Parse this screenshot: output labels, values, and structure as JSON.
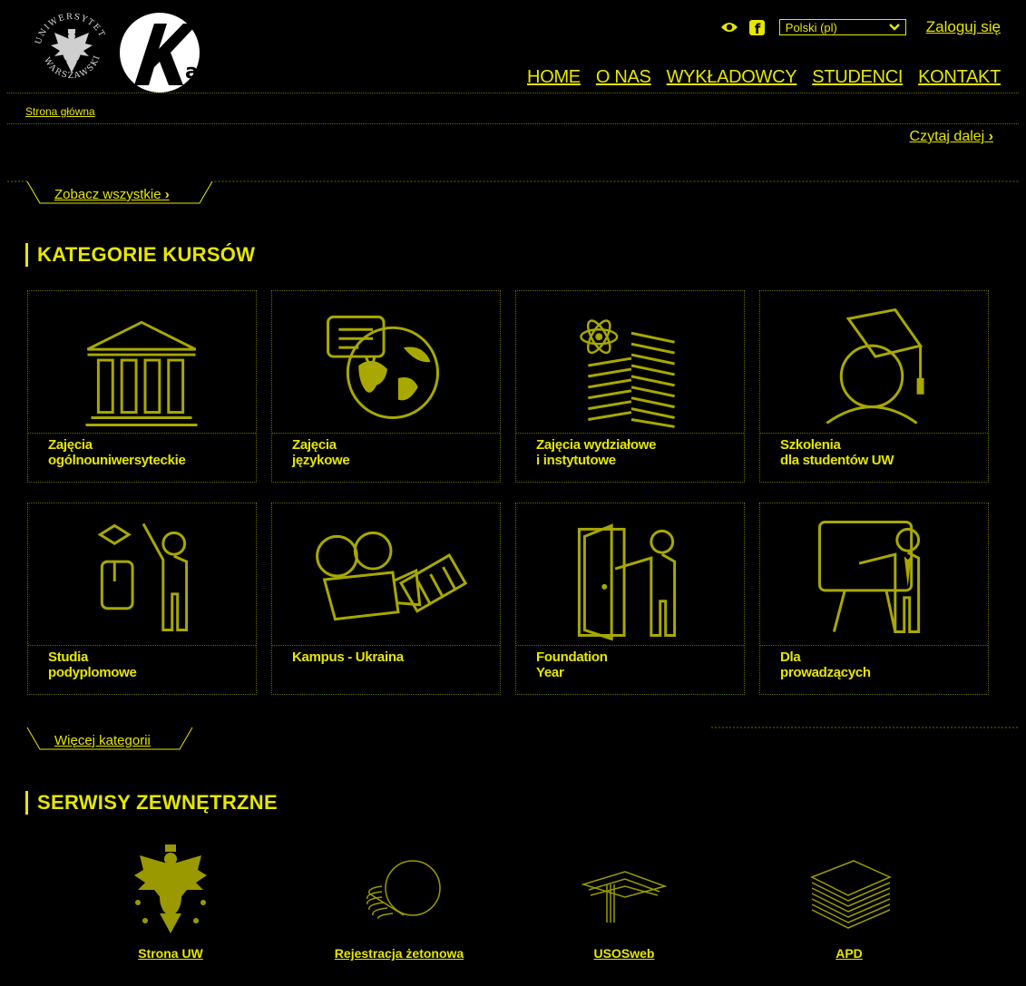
{
  "header": {
    "lang_value": "Polski (pl)",
    "login": "Zaloguj się",
    "nav": [
      "HOME",
      "O NAS",
      "WYKŁADOWCY",
      "STUDENCI",
      "KONTAKT"
    ],
    "uw_seal_text": "UNIWERSYTET WARSZAWSKI"
  },
  "breadcrumb": "Strona główna",
  "read_more": "Czytaj dalej",
  "see_all": "Zobacz wszystkie",
  "categories": {
    "title": "KATEGORIE KURSÓW",
    "items": [
      {
        "line1": "Zajęcia",
        "line2": "ogólnouniwersyteckie",
        "icon": "university-building-icon"
      },
      {
        "line1": "Zajęcia",
        "line2": "językowe",
        "icon": "globe-speech-icon"
      },
      {
        "line1": "Zajęcia wydziałowe",
        "line2": "i instytutowe",
        "icon": "atom-buildings-icon"
      },
      {
        "line1": "Szkolenia",
        "line2": "dla studentów UW",
        "icon": "graduate-icon"
      },
      {
        "line1": "Studia",
        "line2": "podyplomowe",
        "icon": "graduation-person-icon"
      },
      {
        "line1": "Kampus - Ukraina",
        "line2": "",
        "icon": "camera-film-icon"
      },
      {
        "line1": "Foundation",
        "line2": "Year",
        "icon": "door-person-icon"
      },
      {
        "line1": "Dla",
        "line2": "prowadzących",
        "icon": "presenter-board-icon"
      }
    ],
    "more": "Więcej kategorii"
  },
  "external": {
    "title": "SERWISY ZEWNĘTRZNE",
    "items": [
      {
        "label": "Strona UW",
        "icon": "eagle-emblem-icon"
      },
      {
        "label": "Rejestracja żetonowa",
        "icon": "coins-icon"
      },
      {
        "label": "USOSweb",
        "icon": "cap-stack-icon"
      },
      {
        "label": "APD",
        "icon": "paper-stack-icon"
      }
    ]
  },
  "colors": {
    "accent": "#e6e600",
    "background": "#000000",
    "dotted_line": "#6a6a00"
  }
}
